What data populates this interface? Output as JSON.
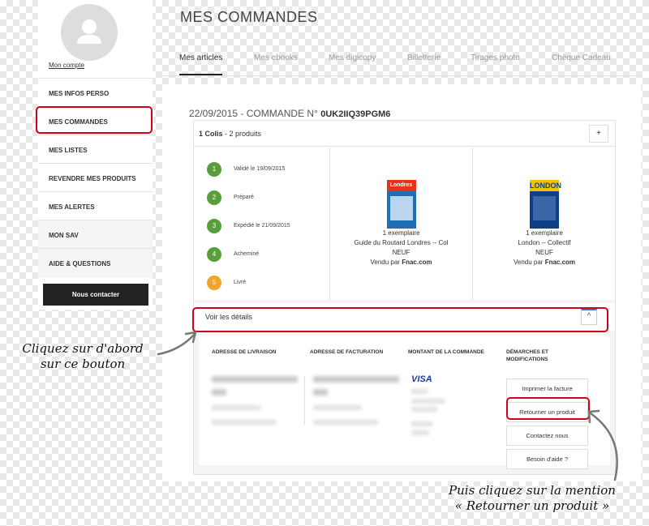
{
  "sidebar": {
    "account_link": "Mon compte",
    "items": [
      {
        "label": "MES INFOS PERSO"
      },
      {
        "label": "MES COMMANDES"
      },
      {
        "label": "MES LISTES"
      },
      {
        "label": "REVENDRE MES PRODUITS"
      },
      {
        "label": "MES ALERTES"
      },
      {
        "label": "MON SAV"
      },
      {
        "label": "AIDE & QUESTIONS"
      }
    ],
    "contact_button": "Nous contacter"
  },
  "header": {
    "title": "MES COMMANDES",
    "tabs": [
      {
        "label": "Mes articles"
      },
      {
        "label": "Mes ebooks"
      },
      {
        "label": "Mes digicopy"
      },
      {
        "label": "Billetterie"
      },
      {
        "label": "Tirages photo"
      },
      {
        "label": "Chèque Cadeau"
      }
    ]
  },
  "order": {
    "date": "22/09/2015",
    "label": "- COMMANDE N°",
    "number": "0UK2IIQ39PGM6",
    "colis": "1 Colis",
    "products_count": "- 2 produits",
    "plus": "+",
    "steps": [
      {
        "num": "1",
        "label": "Validé le 19/09/2015",
        "color": "#5a9e3c"
      },
      {
        "num": "2",
        "label": "Préparé",
        "color": "#5a9e3c"
      },
      {
        "num": "3",
        "label": "Expédié le 21/09/2015",
        "color": "#5a9e3c"
      },
      {
        "num": "4",
        "label": "Acheminé",
        "color": "#5a9e3c"
      },
      {
        "num": "5",
        "label": "Livré",
        "color": "#f0a526"
      }
    ],
    "products": [
      {
        "cover_title": "Londres",
        "quantity": "1 exemplaire",
        "title": "Guide du Routard Londres -- Col",
        "condition": "NEUF",
        "seller_prefix": "Vendu par",
        "seller": "Fnac.com"
      },
      {
        "cover_title": "LONDON",
        "quantity": "1 exemplaire",
        "title": "London -- Collectif",
        "condition": "NEUF",
        "seller_prefix": "Vendu par",
        "seller": "Fnac.com"
      }
    ],
    "details_toggle": "Voir les détails",
    "chevron": "^",
    "columns": {
      "delivery": "ADRESSE DE LIVRAISON",
      "billing": "ADRESSE DE FACTURATION",
      "amount": "MONTANT DE LA COMMANDE",
      "actions": "DÉMARCHES ET MODIFICATIONS"
    },
    "payment_brand": "VISA",
    "actions": [
      {
        "label": "Imprimer la facture"
      },
      {
        "label": "Retourner un produit"
      },
      {
        "label": "Contactez nous"
      },
      {
        "label": "Besoin d'aide ?"
      }
    ]
  },
  "annotations": {
    "first_line1": "Cliquez sur d'abord",
    "first_line2": "sur ce bouton",
    "second_line1": "Puis cliquez sur la mention",
    "second_line2": "« Retourner un produit »"
  },
  "colors": {
    "highlight": "#d0021b",
    "active_step": "#5a9e3c",
    "pending_step": "#f0a526"
  }
}
